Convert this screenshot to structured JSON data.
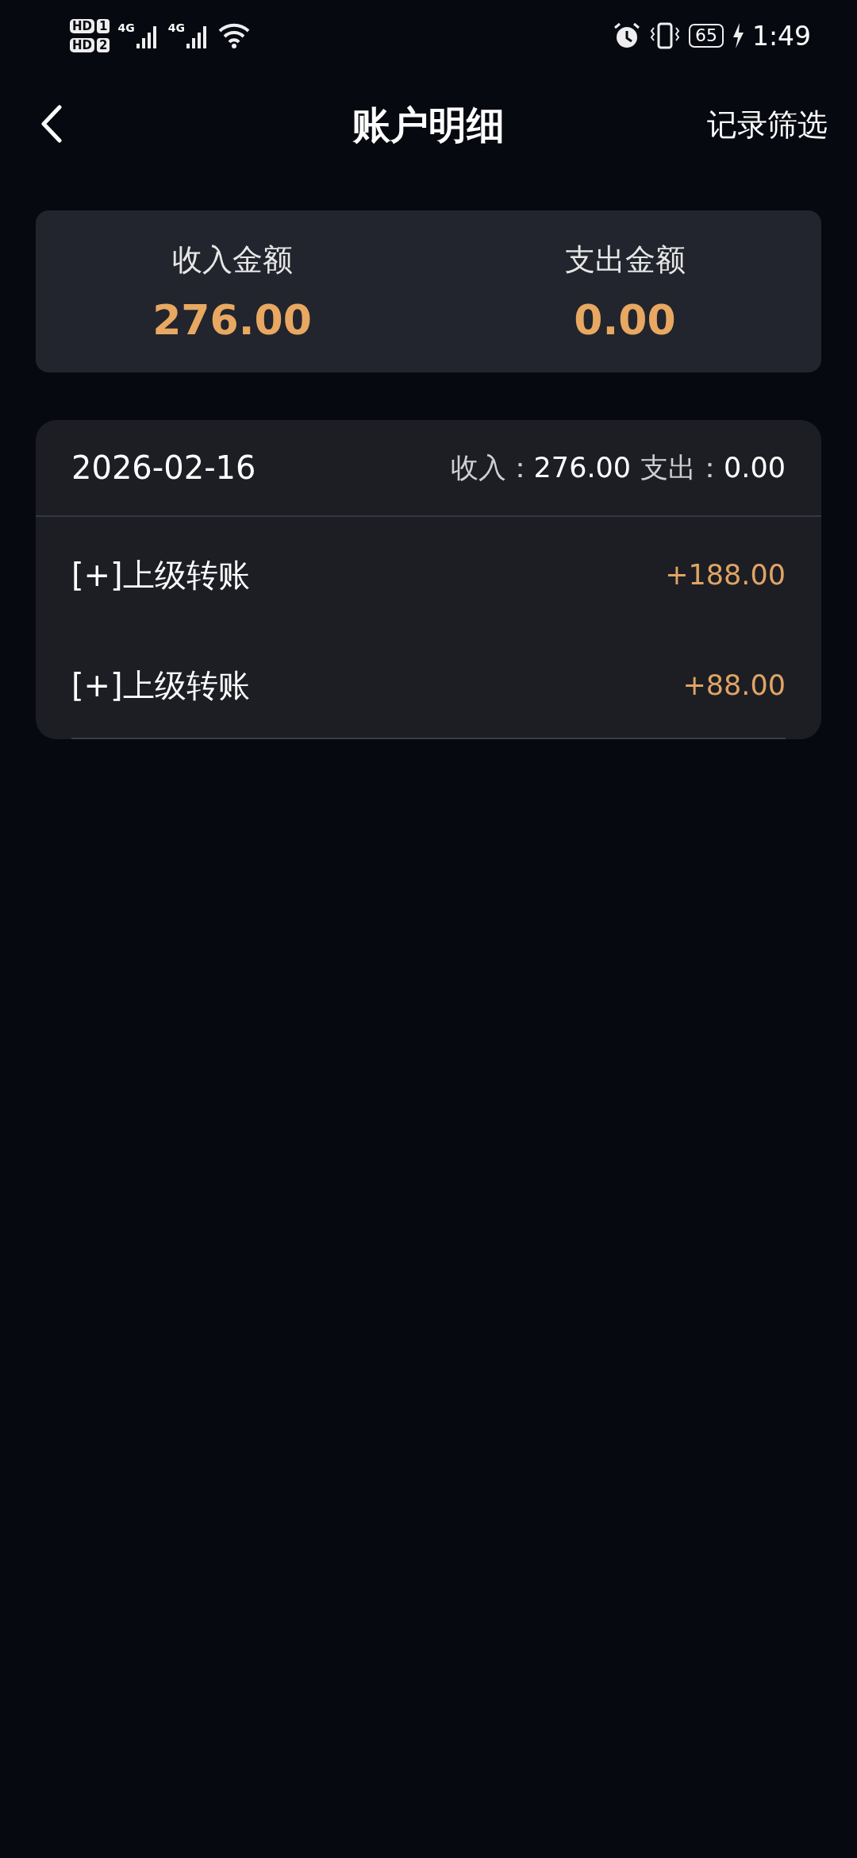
{
  "status_bar": {
    "sims": [
      {
        "label": "HD",
        "slot": "1"
      },
      {
        "label": "HD",
        "slot": "2"
      }
    ],
    "networks": [
      "4G",
      "4G"
    ],
    "battery": "65",
    "charging": true,
    "time": "1:49"
  },
  "header": {
    "title": "账户明细",
    "action": "记录筛选"
  },
  "summary": [
    {
      "label": "收入金额",
      "amount": "276.00"
    },
    {
      "label": "支出金额",
      "amount": "0.00"
    }
  ],
  "days": [
    {
      "date": "2026-02-16",
      "income_label": "收入：",
      "income": "276.00",
      "expense_label": "支出：",
      "expense": "0.00",
      "entries": [
        {
          "title": "[+]上级转账",
          "amount": "+188.00"
        },
        {
          "title": "[+]上级转账",
          "amount": "+88.00"
        }
      ]
    }
  ]
}
